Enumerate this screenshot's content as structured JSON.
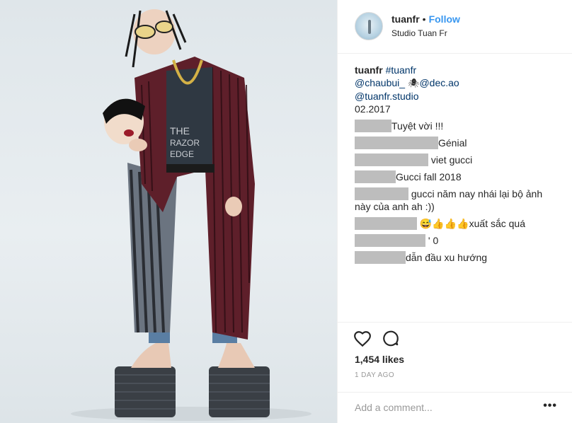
{
  "header": {
    "username": "tuanfr",
    "separator": "•",
    "follow_label": "Follow",
    "location": "Studio Tuan Fr"
  },
  "caption": {
    "username": "tuanfr",
    "hashtag": "#tuanfr",
    "mention_1": "@chaubui_",
    "spider_emoji": "🕷",
    "mention_2": "@dec.ao",
    "mention_3": "@tuanfr.studio",
    "date": "02.2017"
  },
  "comments": [
    {
      "redacted": true,
      "text": "Tuyệt vời !!!"
    },
    {
      "redacted": true,
      "text": "Génial"
    },
    {
      "redacted": true,
      "text": "viet gucci"
    },
    {
      "redacted": true,
      "text": "Gucci fall 2018"
    },
    {
      "redacted": true,
      "text": "gucci năm nay nhái lại bộ ảnh này của anh ah :))"
    },
    {
      "redacted": true,
      "text": "😅👍👍👍xuất sắc quá"
    },
    {
      "redacted": true,
      "text": "' 0"
    },
    {
      "redacted": true,
      "text": "dẫn đầu xu hướng"
    }
  ],
  "actions": {
    "like_icon": "heart-icon",
    "comment_icon": "comment-bubble-icon",
    "likes_count": "1,454 likes",
    "time_ago": "1 DAY AGO",
    "add_comment_placeholder": "Add a comment...",
    "more_label": "•••"
  },
  "colors": {
    "link": "#003569",
    "follow": "#3897f0",
    "redaction": "#bdbdbd",
    "divider": "#efefef"
  }
}
